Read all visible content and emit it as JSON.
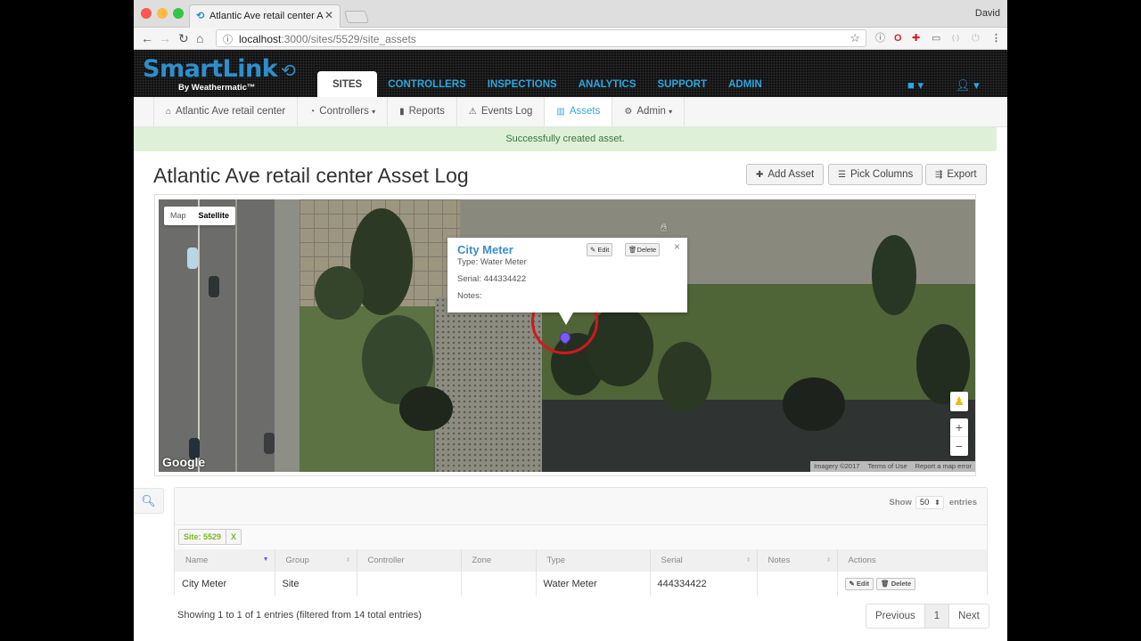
{
  "browser": {
    "tab_title": "Atlantic Ave retail center Asset",
    "tab_icon": "smartlink-favicon",
    "profile_name": "David",
    "url_host": "localhost",
    "url_path": ":3000/sites/5529/site_assets",
    "extension_icons": [
      "info-icon",
      "opera-icon",
      "extension-icon",
      "cast-icon",
      "ext-icon",
      "power-icon",
      "menu-icon"
    ]
  },
  "app": {
    "logo_main": "SmartLink",
    "logo_sub": "By Weathermatic™",
    "main_nav": [
      {
        "label": "SITES",
        "active": true
      },
      {
        "label": "CONTROLLERS",
        "active": false
      },
      {
        "label": "INSPECTIONS",
        "active": false
      },
      {
        "label": "ANALYTICS",
        "active": false
      },
      {
        "label": "SUPPORT",
        "active": false
      },
      {
        "label": "ADMIN",
        "active": false
      }
    ],
    "sub_nav": [
      {
        "label": "Atlantic Ave retail center",
        "icon": "home-icon"
      },
      {
        "label": "Controllers",
        "icon": "dashboard-icon",
        "dropdown": true
      },
      {
        "label": "Reports",
        "icon": "bar-chart-icon"
      },
      {
        "label": "Events Log",
        "icon": "warning-icon"
      },
      {
        "label": "Assets",
        "icon": "columns-icon",
        "active": true
      },
      {
        "label": "Admin",
        "icon": "gear-icon",
        "dropdown": true
      }
    ]
  },
  "alert": {
    "message": "Successfully created asset."
  },
  "page": {
    "title": "Atlantic Ave retail center Asset Log",
    "buttons": {
      "add_asset": "Add Asset",
      "pick_columns": "Pick Columns",
      "export": "Export"
    }
  },
  "map": {
    "type_options": {
      "map": "Map",
      "satellite": "Satellite"
    },
    "selected_type": "Satellite",
    "google_label": "Google",
    "attribution": [
      "Imagery ©2017",
      "Terms of Use",
      "Report a map error"
    ],
    "zoom_in": "+",
    "zoom_out": "−",
    "info_window": {
      "title": "City Meter",
      "type_line": "Type: Water Meter",
      "serial_line": "Serial: 444334422",
      "notes_line": "Notes:",
      "edit_label": "Edit",
      "delete_label": "Delete",
      "close": "×"
    },
    "marker_color": "#7a5cf0",
    "highlight_color": "#d6161e"
  },
  "table": {
    "show_label": "Show",
    "entries_value": "50",
    "entries_label": "entries",
    "filter_tag": "Site: 5529",
    "filter_remove": "X",
    "columns": [
      "Name",
      "Group",
      "Controller",
      "Zone",
      "Type",
      "Serial",
      "Notes",
      "Actions"
    ],
    "rows": [
      {
        "name": "City Meter",
        "group": "Site",
        "controller": "",
        "zone": "",
        "type": "Water Meter",
        "serial": "444334422",
        "notes": "",
        "edit": "Edit",
        "delete": "Delete"
      }
    ],
    "info": "Showing 1 to 1 of 1 entries (filtered from 14 total entries)",
    "pagination": {
      "previous": "Previous",
      "current": "1",
      "next": "Next"
    }
  }
}
